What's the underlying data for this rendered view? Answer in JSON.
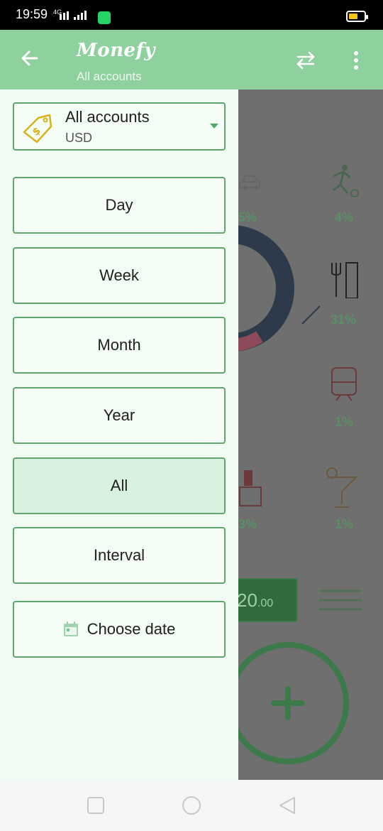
{
  "status_bar": {
    "time": "19:59",
    "network": "4G",
    "battery_color": "#f2c318"
  },
  "app_bar": {
    "brand": "Monefy",
    "subtitle": "All accounts",
    "back_icon": "arrow-left-icon",
    "transfer_icon": "swap-arrows-icon",
    "menu_icon": "more-vertical-icon"
  },
  "account_selector": {
    "name": "All accounts",
    "currency": "USD",
    "icon": "price-tag-dollar-icon",
    "caret_icon": "caret-down-icon"
  },
  "periods": [
    {
      "label": "Day",
      "selected": false
    },
    {
      "label": "Week",
      "selected": false
    },
    {
      "label": "Month",
      "selected": false
    },
    {
      "label": "Year",
      "selected": false
    },
    {
      "label": "All",
      "selected": true
    },
    {
      "label": "Interval",
      "selected": false
    }
  ],
  "choose_date": {
    "label": "Choose date",
    "icon": "calendar-icon"
  },
  "background": {
    "percentages": [
      "5%",
      "4%",
      "31%",
      "1%",
      "3%",
      "1%"
    ],
    "amount_partial": "20",
    "amount_cents": ".00"
  },
  "colors": {
    "accent": "#8fd19e",
    "border": "#5fa56d",
    "drawer_bg": "#f0fbf3",
    "selected_bg": "#d9f1df"
  }
}
